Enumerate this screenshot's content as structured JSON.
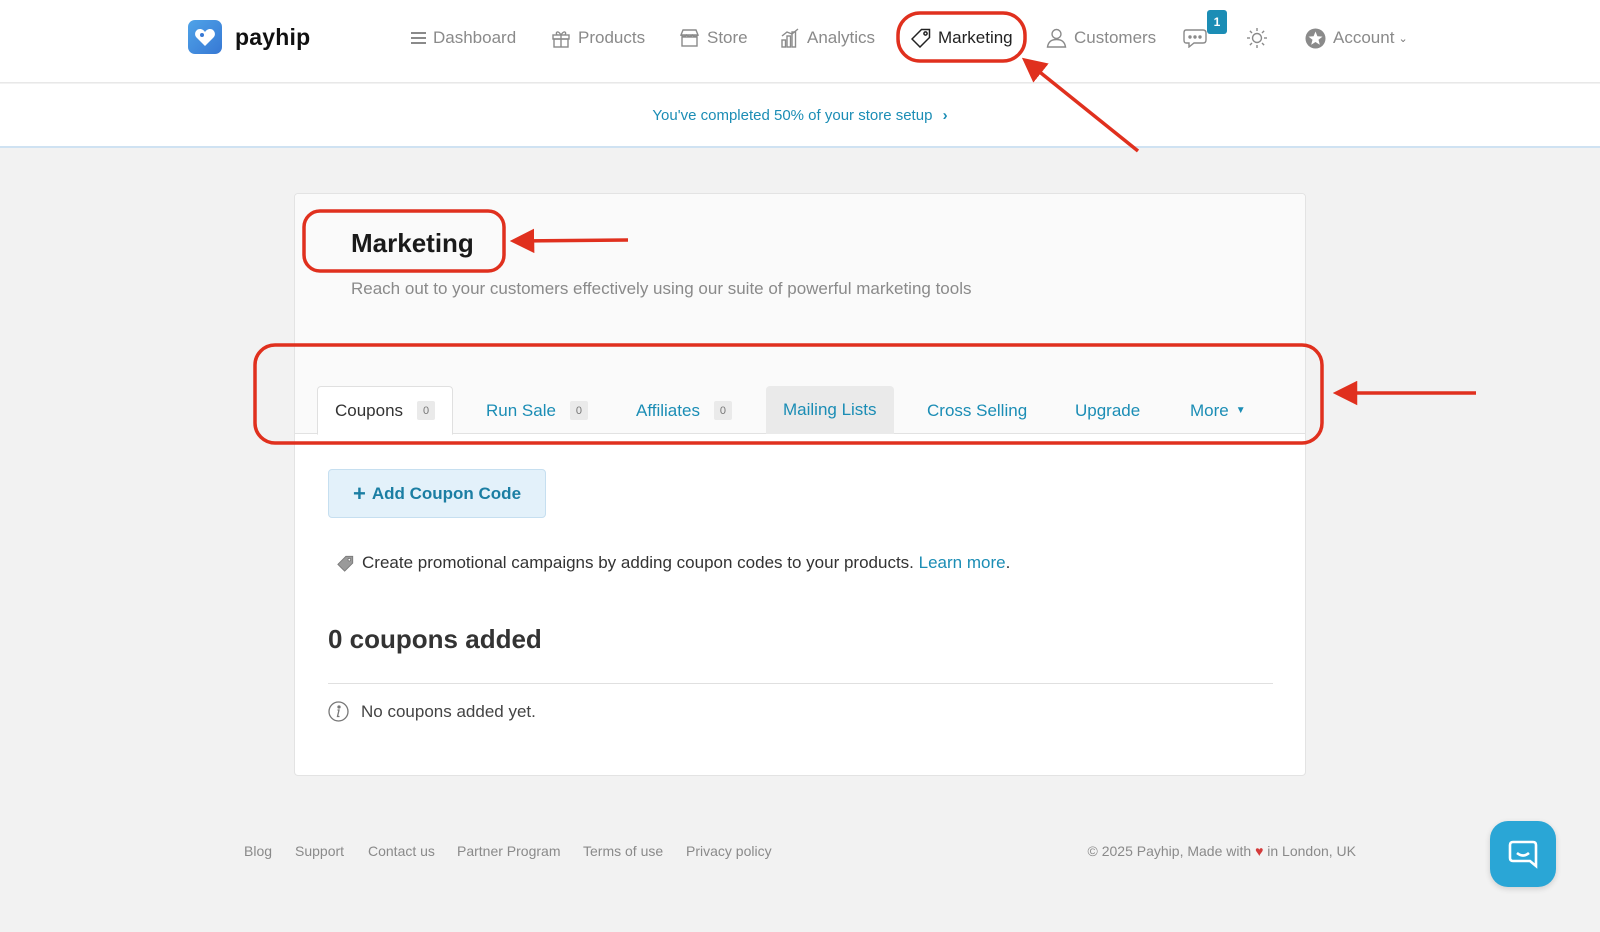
{
  "brand": {
    "name": "payhip"
  },
  "nav": {
    "dashboard": "Dashboard",
    "products": "Products",
    "store": "Store",
    "analytics": "Analytics",
    "marketing": "Marketing",
    "customers": "Customers",
    "messages_badge": "1",
    "account": "Account"
  },
  "setup": {
    "text": "You've completed 50% of your store setup"
  },
  "marketing": {
    "title": "Marketing",
    "subtitle": "Reach out to your customers effectively using our suite of powerful marketing tools",
    "tabs": {
      "coupons": {
        "label": "Coupons",
        "count": "0"
      },
      "run_sale": {
        "label": "Run Sale",
        "count": "0"
      },
      "affiliates": {
        "label": "Affiliates",
        "count": "0"
      },
      "mailing_lists": {
        "label": "Mailing Lists"
      },
      "cross_selling": {
        "label": "Cross Selling"
      },
      "upgrade": {
        "label": "Upgrade"
      },
      "more": {
        "label": "More"
      }
    },
    "add_button": "Add Coupon Code",
    "promo_text": "Create promotional campaigns by adding coupon codes to your products.",
    "promo_link": "Learn more",
    "promo_end": ".",
    "coupon_count_heading": "0 coupons added",
    "empty_text": "No coupons added yet."
  },
  "footer": {
    "links": [
      "Blog",
      "Support",
      "Contact us",
      "Partner Program",
      "Terms of use",
      "Privacy policy"
    ],
    "copyright_pre": "© 2025 Payhip, Made with",
    "heart": "♥",
    "copyright_post": "in London, UK"
  },
  "colors": {
    "accent": "#1b8db5",
    "annotation": "#e0301e",
    "chat": "#2aa6d6"
  },
  "icons": [
    "menu-icon",
    "gift-icon",
    "store-icon",
    "analytics-icon",
    "tag-icon",
    "user-icon",
    "chat-icon",
    "sun-icon",
    "account-icon",
    "info-icon",
    "support-chat-icon"
  ]
}
